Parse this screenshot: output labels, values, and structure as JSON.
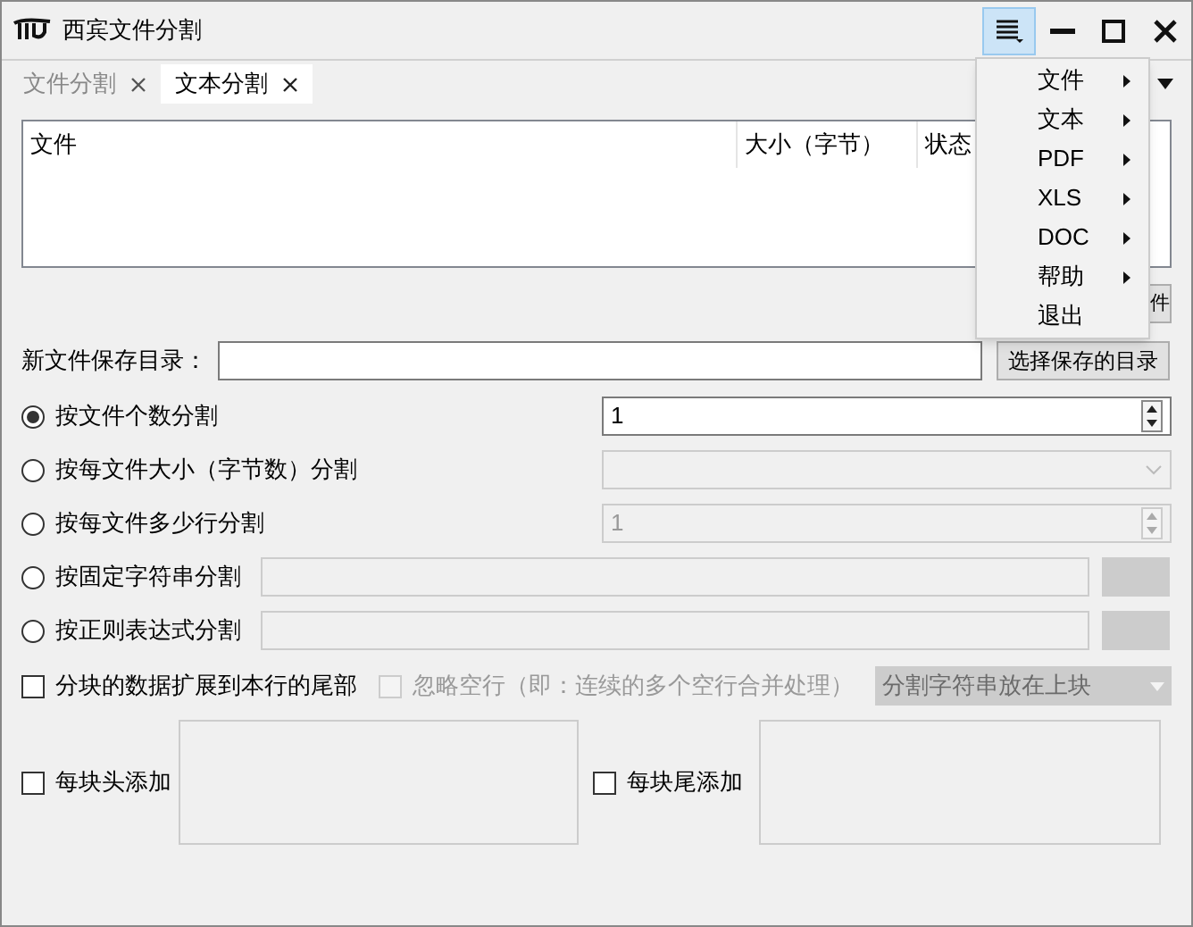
{
  "window": {
    "title": "西宾文件分割"
  },
  "tabs": [
    {
      "label": "文件分割",
      "selected": false
    },
    {
      "label": "文本分割",
      "selected": true
    }
  ],
  "file_table": {
    "columns": [
      "文件",
      "大小（字节）",
      "状态"
    ]
  },
  "add_button": "件",
  "save_dir": {
    "label": "新文件保存目录：",
    "button": "选择保存的目录"
  },
  "split_modes": [
    {
      "label": "按文件个数分割",
      "selected": true,
      "kind": "spin",
      "value": "1",
      "disabled": false
    },
    {
      "label": "按每文件大小（字节数）分割",
      "selected": false,
      "kind": "select",
      "disabled": true
    },
    {
      "label": "按每文件多少行分割",
      "selected": false,
      "kind": "spin",
      "value": "1",
      "disabled": true
    },
    {
      "label": "按固定字符串分割",
      "selected": false,
      "kind": "text",
      "disabled": true
    },
    {
      "label": "按正则表达式分割",
      "selected": false,
      "kind": "text",
      "disabled": true
    }
  ],
  "options": [
    {
      "label": "分块的数据扩展到本行的尾部",
      "checked": false,
      "disabled": false
    },
    {
      "label": "忽略空行（即：连续的多个空行合并处理）",
      "checked": false,
      "disabled": true
    }
  ],
  "separator_position": {
    "value": "分割字符串放在上块",
    "disabled": true
  },
  "block_fields": [
    {
      "label": "每块头添加",
      "checked": false
    },
    {
      "label": "每块尾添加",
      "checked": false
    }
  ],
  "menu": {
    "items": [
      {
        "label": "文件",
        "submenu": true
      },
      {
        "label": "文本",
        "submenu": true
      },
      {
        "label": "PDF",
        "submenu": true
      },
      {
        "label": "XLS",
        "submenu": true
      },
      {
        "label": "DOC",
        "submenu": true
      },
      {
        "label": "帮助",
        "submenu": true
      },
      {
        "label": "退出",
        "submenu": false
      }
    ]
  }
}
